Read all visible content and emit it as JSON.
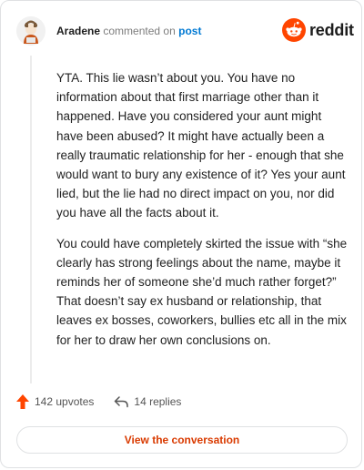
{
  "header": {
    "username": "Aradene",
    "action_text": "commented on",
    "post_link": "post",
    "brand_name": "reddit"
  },
  "comment": {
    "paragraphs": [
      "YTA. This lie wasn’t about you. You have no information about that first marriage other than it happened. Have you considered your aunt might have been abused? It might have actually been a really traumatic relationship for her - enough that she would want to bury any existence of it? Yes your aunt lied, but the lie had no direct impact on you, nor did you have all the facts about it.",
      "You could have completely skirted the issue with “she clearly has strong feelings about the name, maybe it reminds her of someone she’d much rather forget?” That doesn’t say ex husband or relationship, that leaves ex bosses, coworkers, bullies etc all in the mix for her to draw her own conclusions on."
    ]
  },
  "actions": {
    "upvotes": "142 upvotes",
    "replies": "14 replies"
  },
  "cta": {
    "label": "View the conversation"
  },
  "colors": {
    "accent": "#ff4500",
    "link": "#0079d3",
    "cta_text": "#d93a00"
  },
  "icons": [
    "avatar",
    "reddit-logo-icon",
    "upvote-arrow-icon",
    "reply-icon"
  ]
}
